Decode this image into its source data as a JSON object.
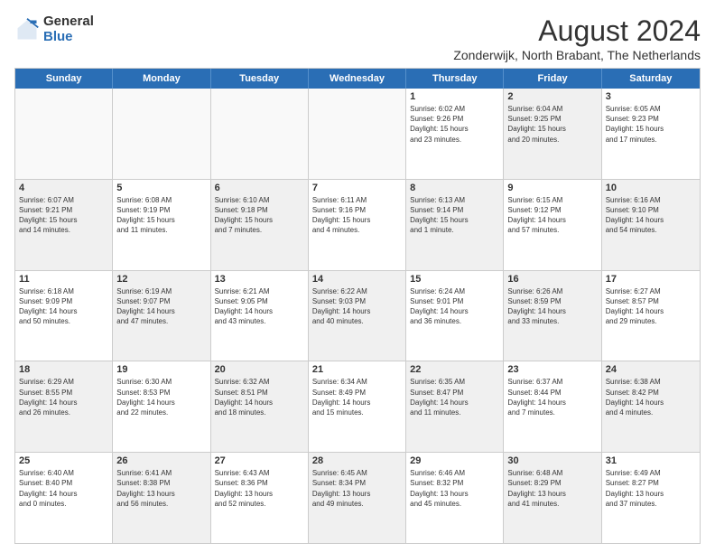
{
  "header": {
    "logo_general": "General",
    "logo_blue": "Blue",
    "title": "August 2024",
    "location": "Zonderwijk, North Brabant, The Netherlands"
  },
  "weekdays": [
    "Sunday",
    "Monday",
    "Tuesday",
    "Wednesday",
    "Thursday",
    "Friday",
    "Saturday"
  ],
  "weeks": [
    [
      {
        "day": "",
        "text": "",
        "empty": true
      },
      {
        "day": "",
        "text": "",
        "empty": true
      },
      {
        "day": "",
        "text": "",
        "empty": true
      },
      {
        "day": "",
        "text": "",
        "empty": true
      },
      {
        "day": "1",
        "text": "Sunrise: 6:02 AM\nSunset: 9:26 PM\nDaylight: 15 hours\nand 23 minutes.",
        "empty": false
      },
      {
        "day": "2",
        "text": "Sunrise: 6:04 AM\nSunset: 9:25 PM\nDaylight: 15 hours\nand 20 minutes.",
        "empty": false,
        "shaded": true
      },
      {
        "day": "3",
        "text": "Sunrise: 6:05 AM\nSunset: 9:23 PM\nDaylight: 15 hours\nand 17 minutes.",
        "empty": false
      }
    ],
    [
      {
        "day": "4",
        "text": "Sunrise: 6:07 AM\nSunset: 9:21 PM\nDaylight: 15 hours\nand 14 minutes.",
        "empty": false,
        "shaded": true
      },
      {
        "day": "5",
        "text": "Sunrise: 6:08 AM\nSunset: 9:19 PM\nDaylight: 15 hours\nand 11 minutes.",
        "empty": false
      },
      {
        "day": "6",
        "text": "Sunrise: 6:10 AM\nSunset: 9:18 PM\nDaylight: 15 hours\nand 7 minutes.",
        "empty": false,
        "shaded": true
      },
      {
        "day": "7",
        "text": "Sunrise: 6:11 AM\nSunset: 9:16 PM\nDaylight: 15 hours\nand 4 minutes.",
        "empty": false
      },
      {
        "day": "8",
        "text": "Sunrise: 6:13 AM\nSunset: 9:14 PM\nDaylight: 15 hours\nand 1 minute.",
        "empty": false,
        "shaded": true
      },
      {
        "day": "9",
        "text": "Sunrise: 6:15 AM\nSunset: 9:12 PM\nDaylight: 14 hours\nand 57 minutes.",
        "empty": false
      },
      {
        "day": "10",
        "text": "Sunrise: 6:16 AM\nSunset: 9:10 PM\nDaylight: 14 hours\nand 54 minutes.",
        "empty": false,
        "shaded": true
      }
    ],
    [
      {
        "day": "11",
        "text": "Sunrise: 6:18 AM\nSunset: 9:09 PM\nDaylight: 14 hours\nand 50 minutes.",
        "empty": false
      },
      {
        "day": "12",
        "text": "Sunrise: 6:19 AM\nSunset: 9:07 PM\nDaylight: 14 hours\nand 47 minutes.",
        "empty": false,
        "shaded": true
      },
      {
        "day": "13",
        "text": "Sunrise: 6:21 AM\nSunset: 9:05 PM\nDaylight: 14 hours\nand 43 minutes.",
        "empty": false
      },
      {
        "day": "14",
        "text": "Sunrise: 6:22 AM\nSunset: 9:03 PM\nDaylight: 14 hours\nand 40 minutes.",
        "empty": false,
        "shaded": true
      },
      {
        "day": "15",
        "text": "Sunrise: 6:24 AM\nSunset: 9:01 PM\nDaylight: 14 hours\nand 36 minutes.",
        "empty": false
      },
      {
        "day": "16",
        "text": "Sunrise: 6:26 AM\nSunset: 8:59 PM\nDaylight: 14 hours\nand 33 minutes.",
        "empty": false,
        "shaded": true
      },
      {
        "day": "17",
        "text": "Sunrise: 6:27 AM\nSunset: 8:57 PM\nDaylight: 14 hours\nand 29 minutes.",
        "empty": false
      }
    ],
    [
      {
        "day": "18",
        "text": "Sunrise: 6:29 AM\nSunset: 8:55 PM\nDaylight: 14 hours\nand 26 minutes.",
        "empty": false,
        "shaded": true
      },
      {
        "day": "19",
        "text": "Sunrise: 6:30 AM\nSunset: 8:53 PM\nDaylight: 14 hours\nand 22 minutes.",
        "empty": false
      },
      {
        "day": "20",
        "text": "Sunrise: 6:32 AM\nSunset: 8:51 PM\nDaylight: 14 hours\nand 18 minutes.",
        "empty": false,
        "shaded": true
      },
      {
        "day": "21",
        "text": "Sunrise: 6:34 AM\nSunset: 8:49 PM\nDaylight: 14 hours\nand 15 minutes.",
        "empty": false
      },
      {
        "day": "22",
        "text": "Sunrise: 6:35 AM\nSunset: 8:47 PM\nDaylight: 14 hours\nand 11 minutes.",
        "empty": false,
        "shaded": true
      },
      {
        "day": "23",
        "text": "Sunrise: 6:37 AM\nSunset: 8:44 PM\nDaylight: 14 hours\nand 7 minutes.",
        "empty": false
      },
      {
        "day": "24",
        "text": "Sunrise: 6:38 AM\nSunset: 8:42 PM\nDaylight: 14 hours\nand 4 minutes.",
        "empty": false,
        "shaded": true
      }
    ],
    [
      {
        "day": "25",
        "text": "Sunrise: 6:40 AM\nSunset: 8:40 PM\nDaylight: 14 hours\nand 0 minutes.",
        "empty": false
      },
      {
        "day": "26",
        "text": "Sunrise: 6:41 AM\nSunset: 8:38 PM\nDaylight: 13 hours\nand 56 minutes.",
        "empty": false,
        "shaded": true
      },
      {
        "day": "27",
        "text": "Sunrise: 6:43 AM\nSunset: 8:36 PM\nDaylight: 13 hours\nand 52 minutes.",
        "empty": false
      },
      {
        "day": "28",
        "text": "Sunrise: 6:45 AM\nSunset: 8:34 PM\nDaylight: 13 hours\nand 49 minutes.",
        "empty": false,
        "shaded": true
      },
      {
        "day": "29",
        "text": "Sunrise: 6:46 AM\nSunset: 8:32 PM\nDaylight: 13 hours\nand 45 minutes.",
        "empty": false
      },
      {
        "day": "30",
        "text": "Sunrise: 6:48 AM\nSunset: 8:29 PM\nDaylight: 13 hours\nand 41 minutes.",
        "empty": false,
        "shaded": true
      },
      {
        "day": "31",
        "text": "Sunrise: 6:49 AM\nSunset: 8:27 PM\nDaylight: 13 hours\nand 37 minutes.",
        "empty": false
      }
    ]
  ]
}
